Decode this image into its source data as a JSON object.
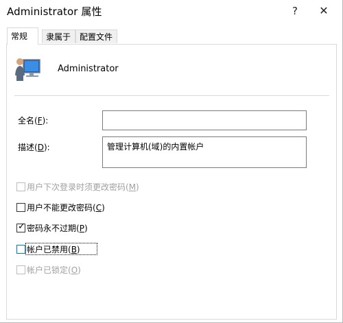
{
  "window": {
    "title": "Administrator 属性",
    "help_glyph": "?",
    "close_glyph": "✕"
  },
  "tabs": [
    {
      "label": "常规",
      "active": true
    },
    {
      "label": "隶属于",
      "active": false
    },
    {
      "label": "配置文件",
      "active": false
    }
  ],
  "user": {
    "name": "Administrator",
    "icon": "user-computer-icon"
  },
  "fields": {
    "full_name_label": "全名(",
    "full_name_key": "F",
    "full_name_suffix": "):",
    "full_name_value": "",
    "desc_label": "描述(",
    "desc_key": "D",
    "desc_suffix": "):",
    "desc_value": "管理计算机(域)的内置帐户"
  },
  "checkboxes": [
    {
      "label": "用户下次登录时须更改密码(",
      "key": "M",
      "suffix": ")",
      "checked": false,
      "disabled": true
    },
    {
      "label": "用户不能更改密码(",
      "key": "C",
      "suffix": ")",
      "checked": false,
      "disabled": false
    },
    {
      "label": "密码永不过期(",
      "key": "P",
      "suffix": ")",
      "checked": true,
      "disabled": false
    },
    {
      "label": "帐户已禁用(",
      "key": "B",
      "suffix": ")",
      "checked": false,
      "disabled": false,
      "focused": true
    },
    {
      "label": "帐户已锁定(",
      "key": "O",
      "suffix": ")",
      "checked": false,
      "disabled": true
    }
  ],
  "colors": {
    "focus": "#0078d7",
    "disabled_text": "#a0a0a0",
    "border": "#d9d9d9"
  }
}
